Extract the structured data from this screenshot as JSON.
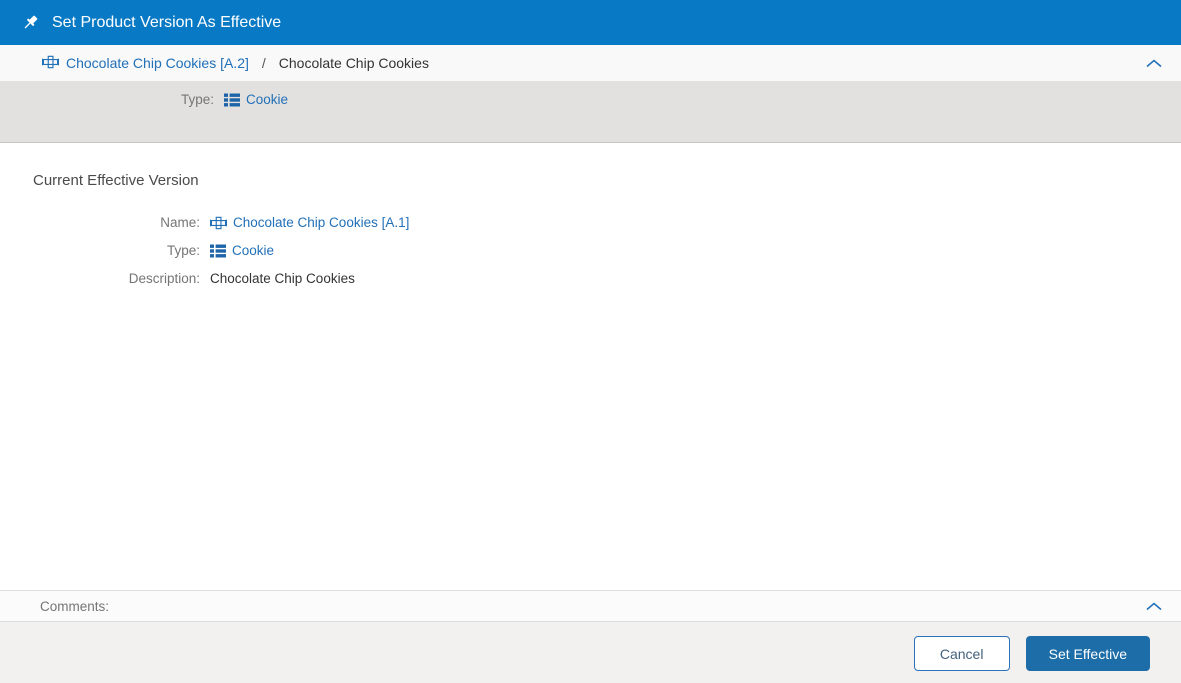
{
  "colors": {
    "titlebar_blue": "#0879c4",
    "link_blue": "#2170b8",
    "type_icon_blue": "#1d64a8",
    "primary_button_blue": "#1d6da8",
    "summary_band_gray": "#e2e1e0",
    "footer_gray": "#f2f1f0"
  },
  "titlebar": {
    "icon": "pushpin-icon",
    "title": "Set Product Version As Effective"
  },
  "breadcrumb": {
    "icon": "product-icon",
    "link": "Chocolate Chip Cookies [A.2]",
    "separator": "/",
    "current": "Chocolate Chip Cookies",
    "collapse_icon": "chevron-up-icon"
  },
  "summary": {
    "type_label": "Type:",
    "type_icon": "list-icon",
    "type_value": "Cookie"
  },
  "current_version": {
    "heading": "Current Effective Version",
    "name_label": "Name:",
    "name_icon": "product-icon",
    "name_value": "Chocolate Chip Cookies [A.1]",
    "type_label": "Type:",
    "type_icon": "list-icon",
    "type_value": "Cookie",
    "description_label": "Description:",
    "description_value": "Chocolate Chip Cookies"
  },
  "comments": {
    "label": "Comments:",
    "collapse_icon": "chevron-up-icon"
  },
  "footer": {
    "cancel": "Cancel",
    "set_effective": "Set Effective"
  }
}
